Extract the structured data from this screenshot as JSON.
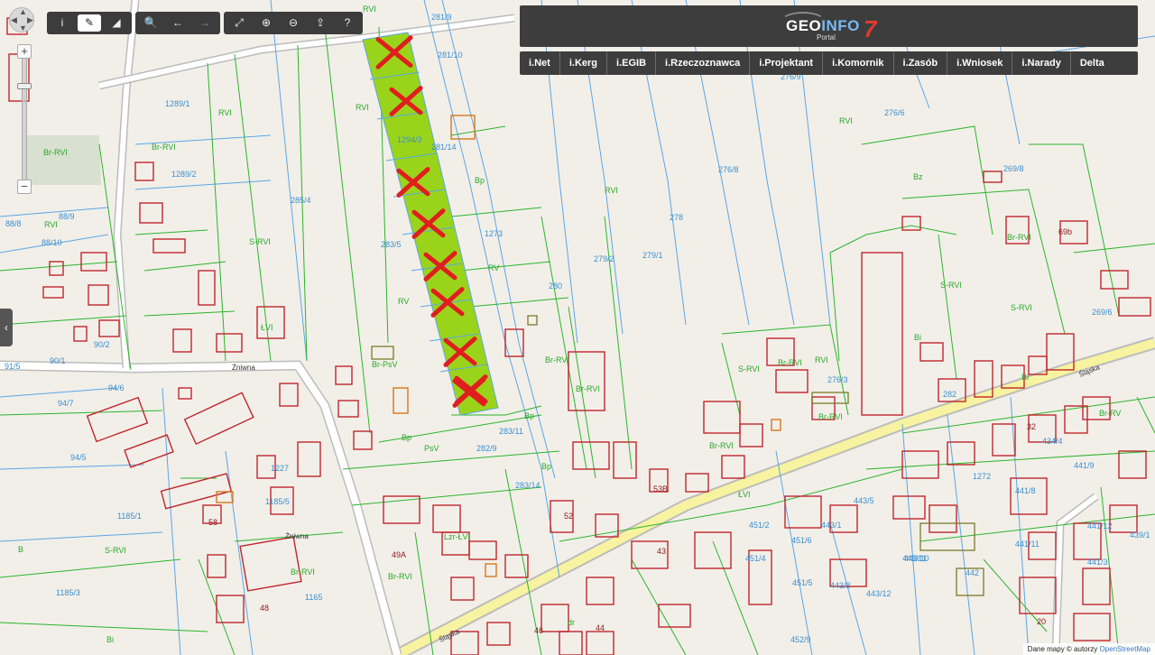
{
  "toolbar": {
    "groups": [
      [
        {
          "name": "info",
          "glyph": "i"
        },
        {
          "name": "pencil",
          "glyph": "✎",
          "active": true
        },
        {
          "name": "measure",
          "glyph": "◢"
        }
      ],
      [
        {
          "name": "search",
          "glyph": "🔍"
        },
        {
          "name": "back",
          "glyph": "←"
        },
        {
          "name": "forward",
          "glyph": "→",
          "dim": true
        }
      ],
      [
        {
          "name": "fullscreen",
          "glyph": "⤢"
        },
        {
          "name": "zoom-in",
          "glyph": "⊕"
        },
        {
          "name": "zoom-out",
          "glyph": "⊖"
        },
        {
          "name": "share",
          "glyph": "⇪"
        },
        {
          "name": "help",
          "glyph": "?"
        }
      ]
    ]
  },
  "zoom": {
    "plus": "+",
    "minus": "−",
    "level_fraction": 0.2
  },
  "side_tab": {
    "glyph": "‹"
  },
  "logo": {
    "geo": "GEO",
    "info": "INFO",
    "seven": "7",
    "sub": "Portal"
  },
  "nav": [
    "i.Net",
    "i.Kerg",
    "i.EGIB",
    "i.Rzeczoznawca",
    "i.Projektant",
    "i.Komornik",
    "i.Zasób",
    "i.Wniosek",
    "i.Narady",
    "Delta"
  ],
  "attribution": {
    "text": "Dane mapy © autorzy",
    "link": "OpenStreetMap"
  },
  "map": {
    "roads": [
      "Śląska",
      "Żniwna",
      "Żniwna",
      "Śląska"
    ],
    "parcels_blue": [
      "281/9",
      "281/10",
      "1289/1",
      "1289/2",
      "285/4",
      "283/5",
      "1294/3",
      "281/14",
      "1273",
      "88/8",
      "88/9",
      "88/10",
      "90/2",
      "90/1",
      "91/5",
      "94/7",
      "94/6",
      "94/5",
      "1185/1",
      "1185/3",
      "1227",
      "1185/5",
      "1165",
      "279/2",
      "279/1",
      "278",
      "276/8",
      "276/9",
      "276/6",
      "269/8",
      "269/6",
      "280",
      "282/9",
      "283/11",
      "283/14",
      "276/3",
      "451/2",
      "451/6",
      "451/4",
      "451/5",
      "443/1",
      "443/5",
      "443/8",
      "443/12",
      "443/11",
      "443/10",
      "442",
      "452/9",
      "441/9",
      "441/8",
      "441/11",
      "441/12",
      "441/3",
      "439/1",
      "434/4",
      "1272",
      "282"
    ],
    "landuse_green": [
      "RVI",
      "RVI",
      "RVI",
      "RV",
      "Br-RVI",
      "S-RVI",
      "RVI",
      "Bp",
      "RV",
      "Br-PsV",
      "Bp",
      "PsV",
      "Br-RVI",
      "Br-RVI",
      "Bp",
      "Bp",
      "S-RVI",
      "RVI",
      "Br-RVI",
      "RVI",
      "Bz",
      "Br-RVI",
      "S-RVI",
      "S-RVI",
      "Bi",
      "RVI",
      "Br-RVI",
      "Br-RVI",
      "S-RVI",
      "Br-RVI",
      "B",
      "Bi",
      "Br-RVI",
      "ŁVI",
      "ŁVI",
      "Lzr-ŁVI",
      "dr",
      "Br-RVI",
      "Br-RV",
      "Bi",
      "Bp",
      "B"
    ],
    "addresses": [
      "49A",
      "53B",
      "52",
      "43",
      "46",
      "44",
      "48",
      "58",
      "69b",
      "32",
      "20"
    ],
    "strikes": 9
  }
}
